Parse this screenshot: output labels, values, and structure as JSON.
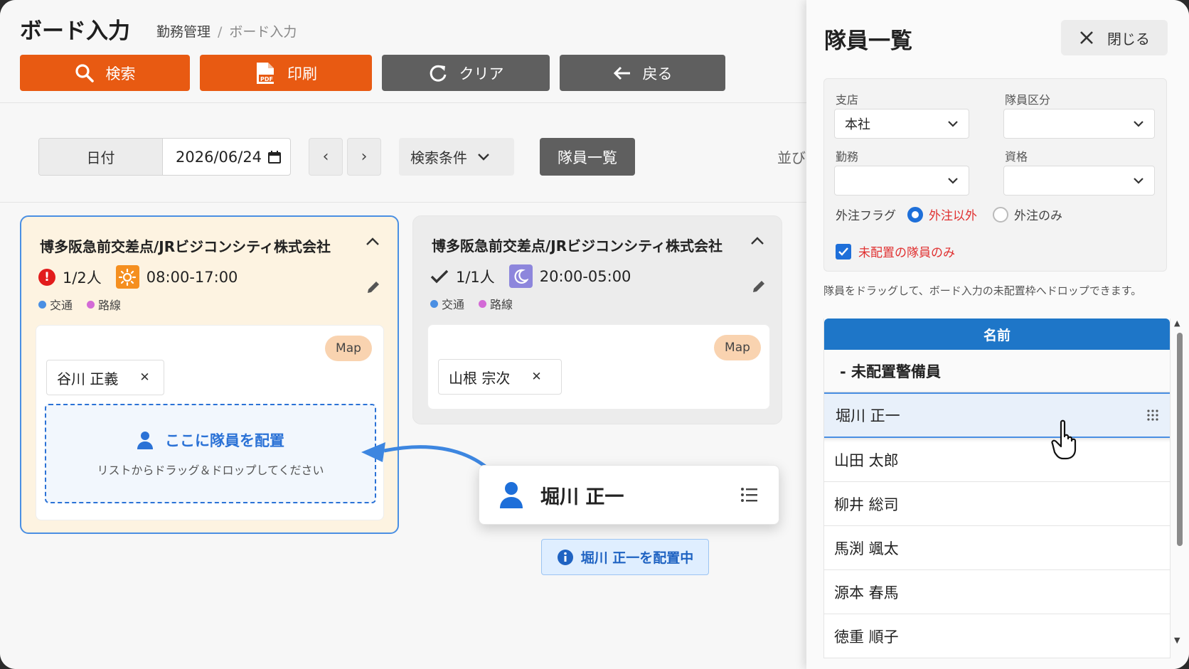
{
  "header": {
    "title": "ボード入力",
    "breadcrumb_parent": "勤務管理",
    "breadcrumb_sep": "/",
    "breadcrumb_current": "ボード入力"
  },
  "toolbar": {
    "search": "検索",
    "print": "印刷",
    "clear": "クリア",
    "back": "戻る"
  },
  "filterbar": {
    "date_label": "日付",
    "date_value": "2026/06/24",
    "prev": "‹",
    "next": "›",
    "conditions": "検索条件",
    "members_button": "隊員一覧",
    "sort_label": "並び"
  },
  "cards": [
    {
      "title": "博多阪急前交差点/JRビジコンシティ株式会社",
      "status": "1/2人",
      "status_icon": "alert-icon",
      "shift": "08:00-17:00",
      "shift_icon": "sun-icon",
      "tags": [
        "交通",
        "路線"
      ],
      "map": "Map",
      "assigned": [
        "谷川 正義"
      ],
      "drop_title": "ここに隊員を配置",
      "drop_sub": "リストからドラッグ＆ドロップしてください"
    },
    {
      "title": "博多阪急前交差点/JRビジコンシティ株式会社",
      "status": "1/1人",
      "status_icon": "check-icon",
      "shift": "20:00-05:00",
      "shift_icon": "moon-icon",
      "tags": [
        "交通",
        "路線"
      ],
      "map": "Map",
      "assigned": [
        "山根 宗次"
      ]
    }
  ],
  "drag": {
    "name": "堀川 正一",
    "placing_status": "堀川 正一を配置中"
  },
  "panel": {
    "title": "隊員一覧",
    "close": "閉じる",
    "filters": {
      "branch_label": "支店",
      "branch_value": "本社",
      "category_label": "隊員区分",
      "category_value": "",
      "duty_label": "勤務",
      "duty_value": "",
      "qualification_label": "資格",
      "qualification_value": "",
      "outsource_label": "外注フラグ",
      "outsource_opt1": "外注以外",
      "outsource_opt2": "外注のみ",
      "unassigned_only": "未配置の隊員のみ"
    },
    "hint": "隊員をドラッグして、ボード入力の未配置枠へドロップできます。",
    "list_header": "名前",
    "group": "- 未配置警備員",
    "members": [
      "堀川 正一",
      "山田 太郎",
      "柳井 総司",
      "馬渕 颯太",
      "源本 春馬",
      "徳重 順子"
    ]
  },
  "colors": {
    "accent_orange": "#e85a12",
    "primary_blue": "#1e76c8",
    "danger": "#e21c1c",
    "tag_traffic": "#4a8fe3",
    "tag_route": "#d36ad6"
  }
}
